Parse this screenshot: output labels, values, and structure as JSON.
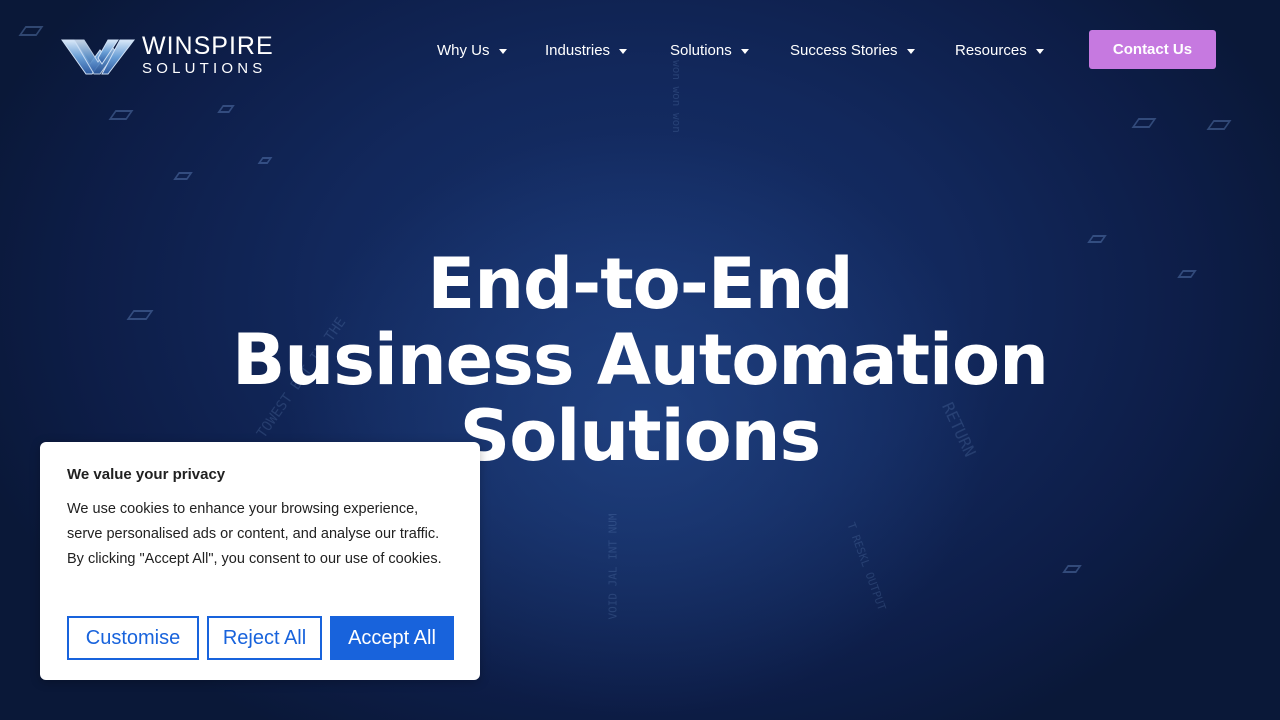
{
  "brand": {
    "name_line1": "WINSPIRE",
    "name_line2": "SOLUTIONS"
  },
  "nav": {
    "items": [
      {
        "label": "Why Us",
        "has_dropdown": true
      },
      {
        "label": "Industries",
        "has_dropdown": true
      },
      {
        "label": "Solutions",
        "has_dropdown": true
      },
      {
        "label": "Success Stories",
        "has_dropdown": true
      },
      {
        "label": "Resources",
        "has_dropdown": true
      }
    ],
    "cta_label": "Contact Us",
    "cta_color": "#c679e0"
  },
  "hero": {
    "title_line1": "End-to-End",
    "title_line2": "Business Automation",
    "title_line3": "Solutions"
  },
  "cookie_banner": {
    "title": "We value your privacy",
    "body": "We use cookies to enhance your browsing experience, serve personalised ads or content, and analyse our traffic. By clicking \"Accept All\", you consent to our use of cookies.",
    "customise_label": "Customise",
    "reject_label": "Reject All",
    "accept_label": "Accept All",
    "accent_color": "#1863dc"
  }
}
